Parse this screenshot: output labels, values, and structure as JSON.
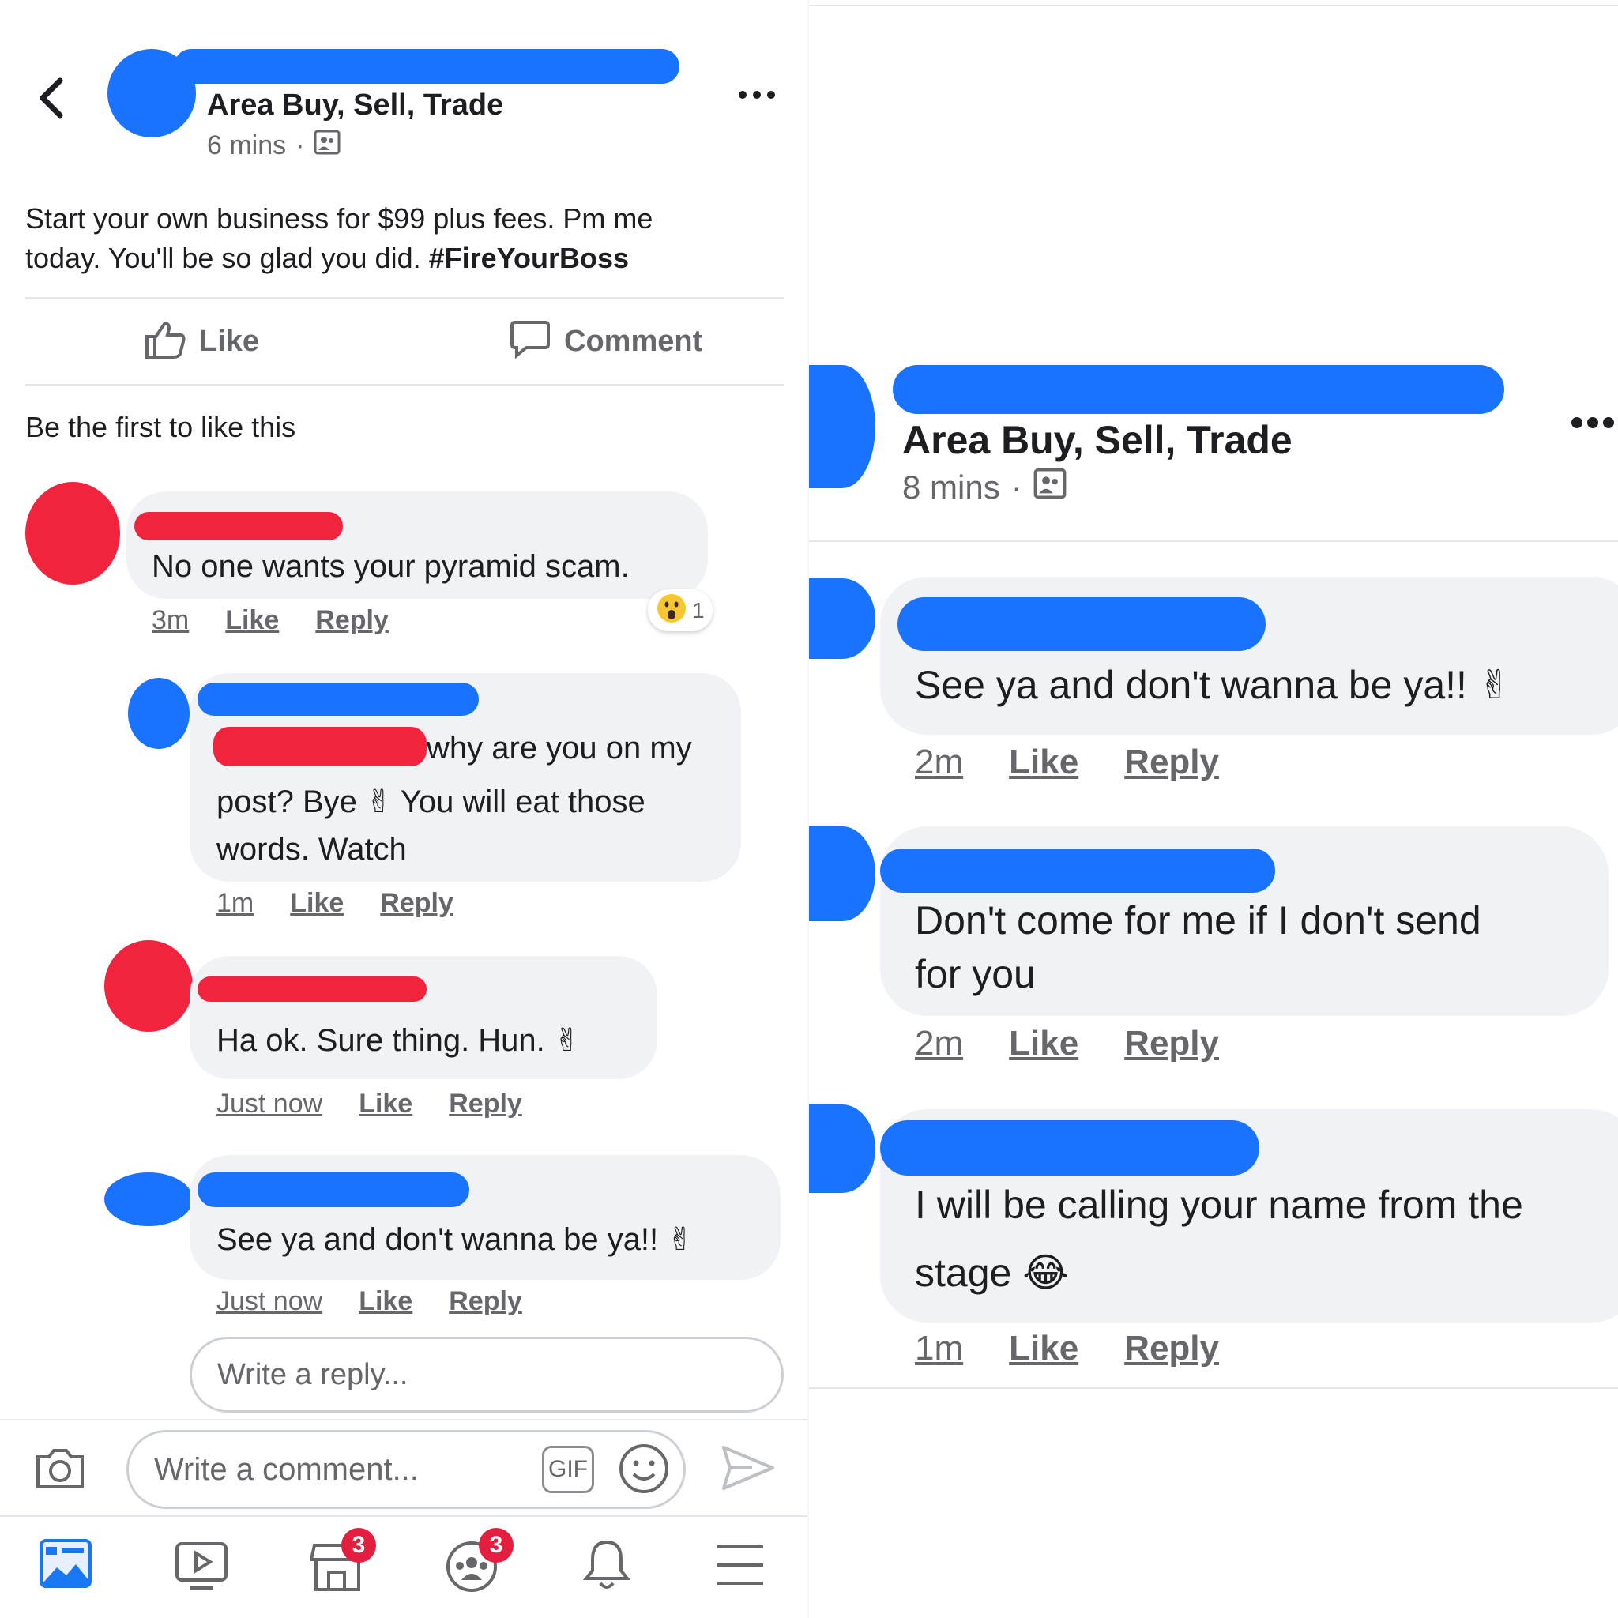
{
  "left": {
    "header": {
      "group_name": "Area Buy, Sell, Trade",
      "time": "6 mins",
      "separator": "·"
    },
    "post": {
      "text_line1": "Start your own business for $99 plus fees. Pm me",
      "text_line2": "today. You'll be so glad you did. ",
      "hashtag": "#FireYourBoss"
    },
    "actions": {
      "like": "Like",
      "comment": "Comment"
    },
    "like_summary": "Be the first to like this",
    "comments": [
      {
        "text": "No one wants your pyramid scam.",
        "time": "3m",
        "like": "Like",
        "reply": "Reply",
        "reaction_count": "1"
      },
      {
        "text_line1": "why are you on my",
        "text_line2": "post? Bye ✌ You will eat those",
        "text_line3": "words. Watch",
        "time": "1m",
        "like": "Like",
        "reply": "Reply"
      },
      {
        "text": "Ha ok. Sure thing. Hun. ✌",
        "time": "Just now",
        "like": "Like",
        "reply": "Reply"
      },
      {
        "text": "See ya and don't wanna be ya!! ✌",
        "time": "Just now",
        "like": "Like",
        "reply": "Reply"
      }
    ],
    "reply_input": {
      "placeholder": "Write a reply..."
    },
    "comment_input": {
      "placeholder": "Write a comment...",
      "gif": "GIF"
    },
    "tabbar": {
      "marketplace_badge": "3",
      "groups_badge": "3"
    }
  },
  "right": {
    "header": {
      "group_name": "Area Buy, Sell, Trade",
      "time": "8 mins",
      "separator": "·"
    },
    "comments": [
      {
        "text": "See ya and don't wanna be ya!! ✌",
        "time": "2m",
        "like": "Like",
        "reply": "Reply"
      },
      {
        "text_line1": "Don't come for me if I don't send",
        "text_line2": "for you",
        "time": "2m",
        "like": "Like",
        "reply": "Reply"
      },
      {
        "text_line1": "I will be calling your name from the",
        "text_line2": "stage 😂",
        "time": "1m",
        "like": "Like",
        "reply": "Reply"
      }
    ]
  },
  "colors": {
    "redaction_blue": "#1a73ff",
    "redaction_red": "#f2233d",
    "bubble_bg": "#f0f2f5",
    "muted_text": "#65676b",
    "badge_red": "#e41e3f"
  }
}
